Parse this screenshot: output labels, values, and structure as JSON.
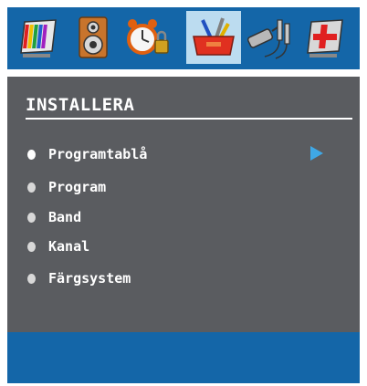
{
  "tabs": [
    {
      "icon": "picture-icon",
      "selected": false
    },
    {
      "icon": "speaker-icon",
      "selected": false
    },
    {
      "icon": "alarm-clock-lock-icon",
      "selected": false
    },
    {
      "icon": "toolbox-icon",
      "selected": true
    },
    {
      "icon": "plugs-icon",
      "selected": false
    },
    {
      "icon": "red-cross-icon",
      "selected": false
    }
  ],
  "menu": {
    "title": "INSTALLERA",
    "items": [
      {
        "label": "Programtablå",
        "active": true
      },
      {
        "label": "Program",
        "active": false
      },
      {
        "label": "Band",
        "active": false
      },
      {
        "label": "Kanal",
        "active": false
      },
      {
        "label": "Färgsystem",
        "active": false
      }
    ]
  },
  "colors": {
    "bar_blue": "#1466a8",
    "panel_gray": "#5a5c60",
    "selected_tab": "#bcdcf0",
    "arrow_blue": "#3fa8e6"
  }
}
